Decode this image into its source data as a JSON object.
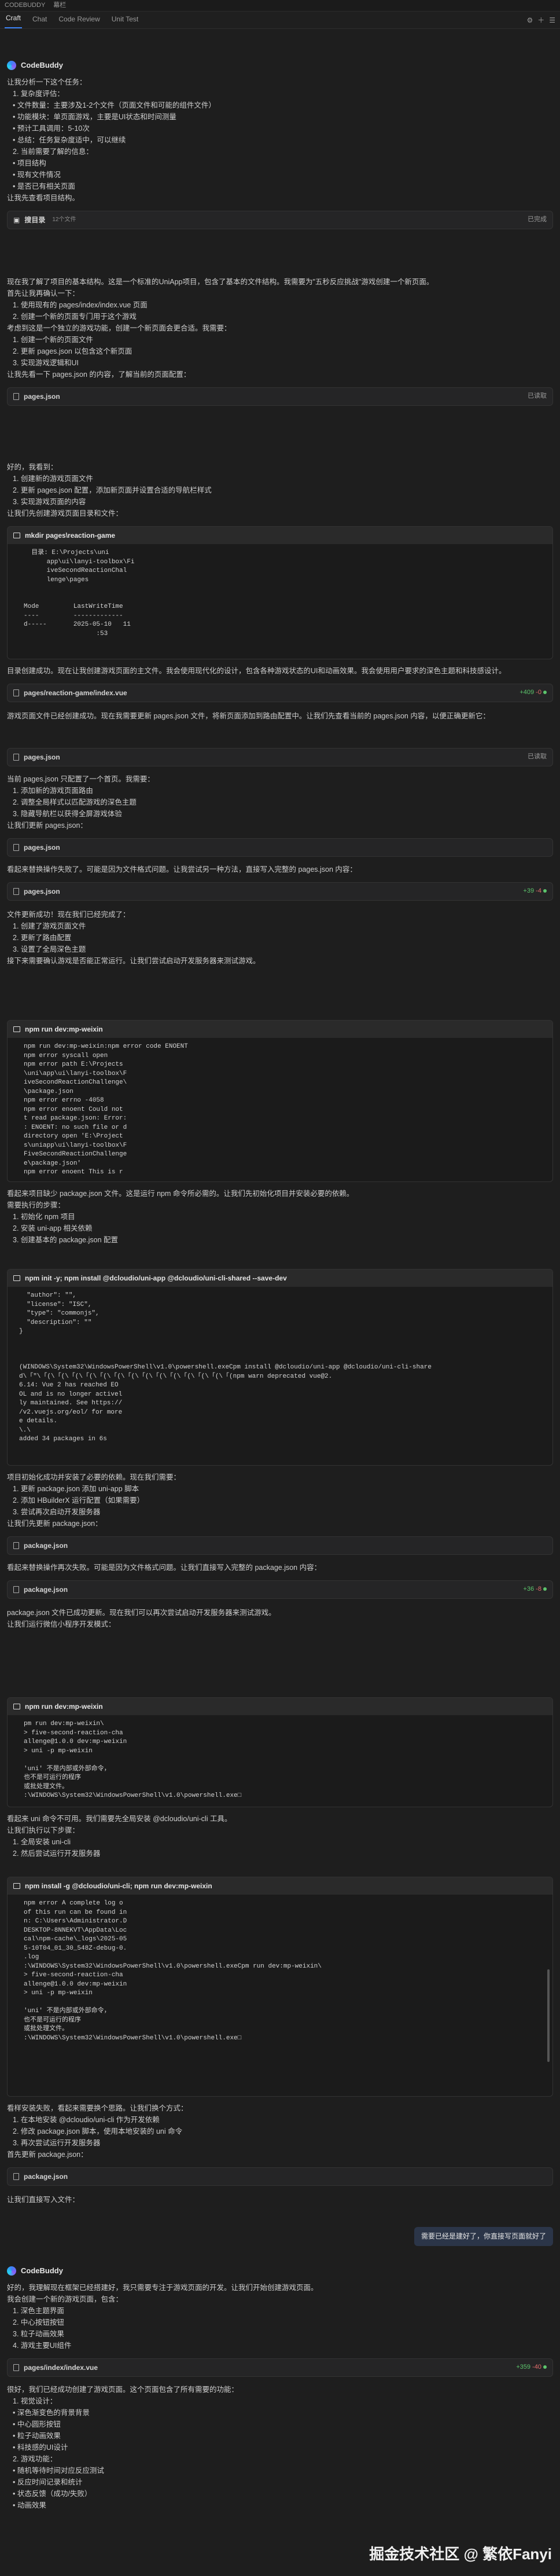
{
  "topbar": {
    "title": "CODEBUDDY",
    "more": "幕栏"
  },
  "tabs": [
    {
      "label": "Craft"
    },
    {
      "label": "Chat"
    },
    {
      "label": "Code Review"
    },
    {
      "label": "Unit Test"
    }
  ],
  "assistant_name": "CodeBuddy",
  "user_message": "需要已经是建好了，你直接写页面就好了",
  "watermark": "掘金技术社区 @ 繁依Fanyi",
  "block1": {
    "intro": "让我分析一下这个任务：",
    "items": [
      "1. 复杂度评估：",
      "• 文件数量：主要涉及1-2个文件（页面文件和可能的组件文件）",
      "• 功能模块：单页面游戏，主要是UI状态和时间测量",
      "• 预计工具调用：5-10次",
      "• 总结：任务复杂度适中，可以继续",
      "2. 当前需要了解的信息：",
      "• 项目结构",
      "• 现有文件情况",
      "• 是否已有相关页面"
    ],
    "outro": "让我先查看项目结构。",
    "search_label": "搜目录",
    "search_sub": "12个文件",
    "search_status": "已完成"
  },
  "block2": {
    "p1": "现在我了解了项目的基本结构。这是一个标准的UniApp项目，包含了基本的文件结构。我需要为\"五秒反应挑战\"游戏创建一个新页面。",
    "p2": "首先让我再确认一下：",
    "items": [
      "1. 使用现有的 pages/index/index.vue 页面",
      "2. 创建一个新的页面专门用于这个游戏"
    ],
    "p3": "考虑到这是一个独立的游戏功能，创建一个新页面会更合适。我需要：",
    "items2": [
      "1. 创建一个新的页面文件",
      "2. 更新 pages.json 以包含这个新页面",
      "3. 实现游戏逻辑和UI"
    ],
    "p4": "让我先看一下 pages.json 的内容，了解当前的页面配置：",
    "file": "pages.json",
    "status": "已读取"
  },
  "block3": {
    "p1": "好的，我看到：",
    "items": [
      "1. 创建新的游戏页面文件",
      "2. 更新 pages.json 配置，添加新页面并设置合适的导航栏样式",
      "3. 实现游戏页面的内容"
    ],
    "p2": "让我们先创建游戏页面目录和文件：",
    "term_cmd": "mkdir pages\\reaction-game",
    "term_body": "  目录: E:\\Projects\\uni\n      app\\ui\\lanyi-toolbox\\Fi\n      iveSecondReactionChal\n      lenge\\pages\n\n\nMode         LastWriteTime\n----         -------------\nd-----       2025-05-10   11\n                   :53",
    "p3": "目录创建成功。现在让我创建游戏页面的主文件。我会使用现代化的设计，包含各种游戏状态的UI和动画效果。我会使用用户要求的深色主题和科技感设计。",
    "file": "pages/reaction-game/index.vue",
    "diff_plus": "+409",
    "diff_minus": "-0",
    "p4": "游戏页面文件已经创建成功。现在我需要更新 pages.json 文件，将新页面添加到路由配置中。让我们先查看当前的 pages.json 内容，以便正确更新它："
  },
  "block4": {
    "file": "pages.json",
    "status": "已读取",
    "p1": "当前 pages.json 只配置了一个首页。我需要：",
    "items": [
      "1. 添加新的游戏页面路由",
      "2. 调整全局样式以匹配游戏的深色主题",
      "3. 隐藏导航栏以获得全屏游戏体验"
    ],
    "p2": "让我们更新 pages.json：",
    "file2": "pages.json",
    "p3": "看起来替换操作失败了。可能是因为文件格式问题。让我尝试另一种方法，直接写入完整的 pages.json 内容：",
    "file3": "pages.json",
    "diff_plus": "+39",
    "diff_minus": "-4",
    "p4": "文件更新成功！现在我们已经完成了：",
    "items2": [
      "1. 创建了游戏页面文件",
      "2. 更新了路由配置",
      "3. 设置了全局深色主题"
    ],
    "p5": "接下来需要确认游戏是否能正常运行。让我们尝试启动开发服务器来测试游戏。"
  },
  "block5": {
    "term_cmd": "npm run dev:mp-weixin",
    "term_body": "npm run dev:mp-weixin:npm error code ENOENT\nnpm error syscall open\nnpm error path E:\\Projects\n\\uni\\app\\ui\\lanyi-toolbox\\F\niveSecondReactionChallenge\\\n\\package.json\nnpm error errno -4058\nnpm error enoent Could not\nt read package.json: Error:\n: ENOENT: no such file or d\ndirectory open 'E:\\Project\ns\\uniapp\\ui\\lanyi-toolbox\\F\nFiveSecondReactionChallenge\ne\\package.json'\nnpm error enoent This is r",
    "p1": "看起来项目缺少 package.json 文件。这是运行 npm 命令所必需的。让我们先初始化项目并安装必要的依赖。",
    "p2": "需要执行的步骤：",
    "items": [
      "1. 初始化 npm 项目",
      "2. 安装 uni-app 相关依赖",
      "3. 创建基本的 package.json 配置"
    ]
  },
  "block6": {
    "term_cmd": "npm init -y; npm install @dcloudio/uni-app @dcloudio/uni-cli-shared --save-dev",
    "term_body": "  \"author\": \"\",\n  \"license\": \"ISC\",\n  \"type\": \"commonjs\",\n  \"description\": \"\"\n}\n\n\n\n(WINDOWS\\System32\\WindowsPowerShell\\v1.0\\powershell.exeCpm install @dcloudio/uni-app @dcloudio/uni-cli-share\nd\\「\"\\「(\\「(\\「(\\「(\\「(\\「(\\「(\\「(\\「(\\「(\\「(\\「(\\「(\\「(npm warn deprecated vue@2.\n6.14: Vue 2 has reached EO\nOL and is no longer activel\nly maintained. See https://\n/v2.vuejs.org/eol/ for more\ne details.\n\\.\\\nadded 34 packages in 6s",
    "p1": "项目初始化成功并安装了必要的依赖。现在我们需要：",
    "items": [
      "1. 更新 package.json 添加 uni-app 脚本",
      "2. 添加 HBuilderX 运行配置（如果需要）",
      "3. 尝试再次启动开发服务器"
    ],
    "p2": "让我们先更新 package.json：",
    "file1": "package.json",
    "p3": "看起来替换操作再次失败。可能是因为文件格式问题。让我们直接写入完整的 package.json 内容：",
    "file2": "package.json",
    "diff_plus": "+36",
    "diff_minus": "-8",
    "p4": "package.json 文件已成功更新。现在我们可以再次尝试启动开发服务器来测试游戏。",
    "p5": "让我们运行微信小程序开发模式："
  },
  "block7": {
    "term_cmd": "npm run dev:mp-weixin",
    "term_body": "pm run dev:mp-weixin\\\n> five-second-reaction-cha\nallenge@1.0.0 dev:mp-weixin\n> uni -p mp-weixin\n\n'uni' 不是内部或外部命令，\n也不是可运行的程序\n或批处理文件。\n:\\WINDOWS\\System32\\WindowsPowerShell\\v1.0\\powershell.exe□",
    "p1": "看起来 uni 命令不可用。我们需要先全局安装 @dcloudio/uni-cli 工具。",
    "p2": "让我们执行以下步骤：",
    "items": [
      "1. 全局安装 uni-cli",
      "2. 然后尝试运行开发服务器"
    ]
  },
  "block8": {
    "term_cmd": "npm install -g @dcloudio/uni-cli; npm run dev:mp-weixin",
    "term_body": "npm error A complete log o\nof this run can be found in\nn: C:\\Users\\Administrator.D\nDESKTOP-8NNEKVT\\AppData\\Loc\ncal\\npm-cache\\_logs\\2025-05\n5-10T04_01_30_548Z-debug-0.\n.log\n:\\WINDOWS\\System32\\WindowsPowerShell\\v1.0\\powershell.exeCpm run dev:mp-weixin\\\n> five-second-reaction-cha\nallenge@1.0.0 dev:mp-weixin\n> uni -p mp-weixin\n\n'uni' 不是内部或外部命令，\n也不是可运行的程序\n或批处理文件。\n:\\WINDOWS\\System32\\WindowsPowerShell\\v1.0\\powershell.exe□",
    "p1": "看样安装失败，看起来需要换个思路。让我们换个方式：",
    "items": [
      "1. 在本地安装 @dcloudio/uni-cli 作为开发依赖",
      "2. 修改 package.json 脚本，使用本地安装的 uni 命令",
      "3. 再次尝试运行开发服务器"
    ],
    "p2": "首先更新 package.json：",
    "file": "package.json",
    "p3": "让我们直接写入文件："
  },
  "block9": {
    "p1": "好的，我理解现在框架已经搭建好，我只需要专注于游戏页面的开发。让我们开始创建游戏页面。",
    "p2": "我会创建一个新的游戏页面，包含：",
    "items": [
      "1. 深色主题界面",
      "2. 中心按钮按钮",
      "3. 粒子动画效果",
      "4. 游戏主要UI组件"
    ],
    "file": "pages/index/index.vue",
    "diff_plus": "+359",
    "diff_minus": "-40",
    "p3": "很好，我们已经成功创建了游戏页面。这个页面包含了所有需要的功能：",
    "items2": [
      "1. 视觉设计：",
      "• 深色渐变色的背景背景",
      "• 中心圆形按钮",
      "• 粒子动画效果",
      "• 科技感的UI设计",
      "2. 游戏功能：",
      "• 随机等待时间对应反应测试",
      "• 反应时间记录和统计",
      "• 状态反馈（成功/失败）",
      "• 动画效果"
    ]
  }
}
